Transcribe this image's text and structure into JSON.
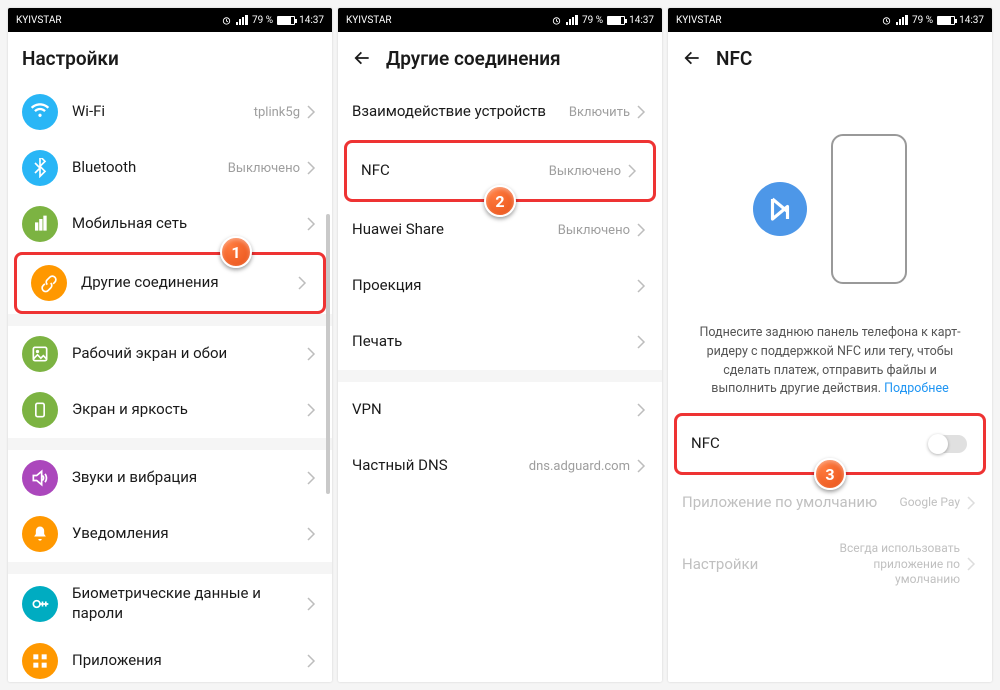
{
  "statusbar": {
    "carrier": "KYIVSTAR",
    "battery": "79 %",
    "time": "14:37"
  },
  "screen1": {
    "title": "Настройки",
    "items": [
      {
        "label": "Wi-Fi",
        "value": "tplink5g",
        "color": "#29b6f6",
        "icon": "wifi"
      },
      {
        "label": "Bluetooth",
        "value": "Выключено",
        "color": "#29b6f6",
        "icon": "bluetooth"
      },
      {
        "label": "Мобильная сеть",
        "value": "",
        "color": "#7cb342",
        "icon": "sim"
      },
      {
        "label": "Другие соединения",
        "value": "",
        "color": "#ff9800",
        "icon": "link"
      },
      {
        "label": "Рабочий экран и обои",
        "value": "",
        "color": "#7cb342",
        "icon": "wallpaper"
      },
      {
        "label": "Экран и яркость",
        "value": "",
        "color": "#7cb342",
        "icon": "brightness"
      },
      {
        "label": "Звуки и вибрация",
        "value": "",
        "color": "#ab47bc",
        "icon": "sound"
      },
      {
        "label": "Уведомления",
        "value": "",
        "color": "#ff9800",
        "icon": "bell"
      },
      {
        "label": "Биометрические данные и пароли",
        "value": "",
        "color": "#00acc1",
        "icon": "key"
      },
      {
        "label": "Приложения",
        "value": "",
        "color": "#ff9800",
        "icon": "apps"
      }
    ]
  },
  "screen2": {
    "title": "Другие соединения",
    "items": [
      {
        "label": "Взаимодействие устройств",
        "value": "Включить"
      },
      {
        "label": "NFC",
        "value": "Выключено"
      },
      {
        "label": "Huawei Share",
        "value": "Выключено"
      },
      {
        "label": "Проекция",
        "value": ""
      },
      {
        "label": "Печать",
        "value": ""
      },
      {
        "label": "VPN",
        "value": ""
      },
      {
        "label": "Частный DNS",
        "value": "dns.adguard.com"
      }
    ]
  },
  "screen3": {
    "title": "NFC",
    "desc": "Поднесите заднюю панель телефона к карт-ридеру с поддержкой NFC или тегу, чтобы сделать платеж, отправить файлы и выполнить другие действия.",
    "more": "Подробнее",
    "toggle_label": "NFC",
    "default_app_label": "Приложение по умолчанию",
    "default_app_value": "Google Pay",
    "settings_label": "Настройки",
    "settings_value": "Всегда использовать приложение по умолчанию"
  },
  "badges": {
    "b1": "1",
    "b2": "2",
    "b3": "3"
  }
}
